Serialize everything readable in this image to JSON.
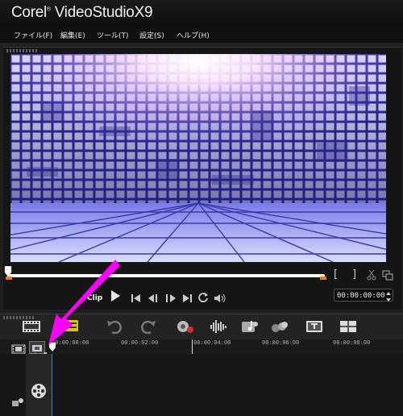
{
  "app": {
    "title_brand": "Corel",
    "title_product": "VideoStudio",
    "title_version": "X9"
  },
  "menu": [
    {
      "label": "ファイル(F)"
    },
    {
      "label": "編集(E)"
    },
    {
      "label": "ツール(T)"
    },
    {
      "label": "設定(S)"
    },
    {
      "label": "ヘルプ(H)"
    }
  ],
  "player": {
    "mode_label": "Clip",
    "timecode": "00:00:00:00",
    "mark_in": "[",
    "mark_out": "]"
  },
  "timeline": {
    "add_remove_label": "+/−",
    "ruler_labels": [
      "00:00:00:00",
      "00:00:02:00",
      "00:00:04:00",
      "00:00:06:00",
      "00:00:08:00"
    ]
  },
  "colors": {
    "accent": "#f07a1a",
    "annotation_arrow": "#ff00ff",
    "track_border": "#4a7dd6"
  },
  "icons": [
    "play-icon",
    "go-to-start-icon",
    "previous-frame-icon",
    "next-frame-icon",
    "go-to-end-icon",
    "repeat-icon",
    "volume-icon",
    "split-icon",
    "enlarge-icon",
    "storyboard-view-icon",
    "timeline-view-icon",
    "undo-icon",
    "redo-icon",
    "record-capture-icon",
    "sound-mixer-icon",
    "auto-music-icon",
    "motion-tracking-icon",
    "subtitle-editor-icon",
    "multi-camera-icon",
    "film-reel-icon"
  ]
}
